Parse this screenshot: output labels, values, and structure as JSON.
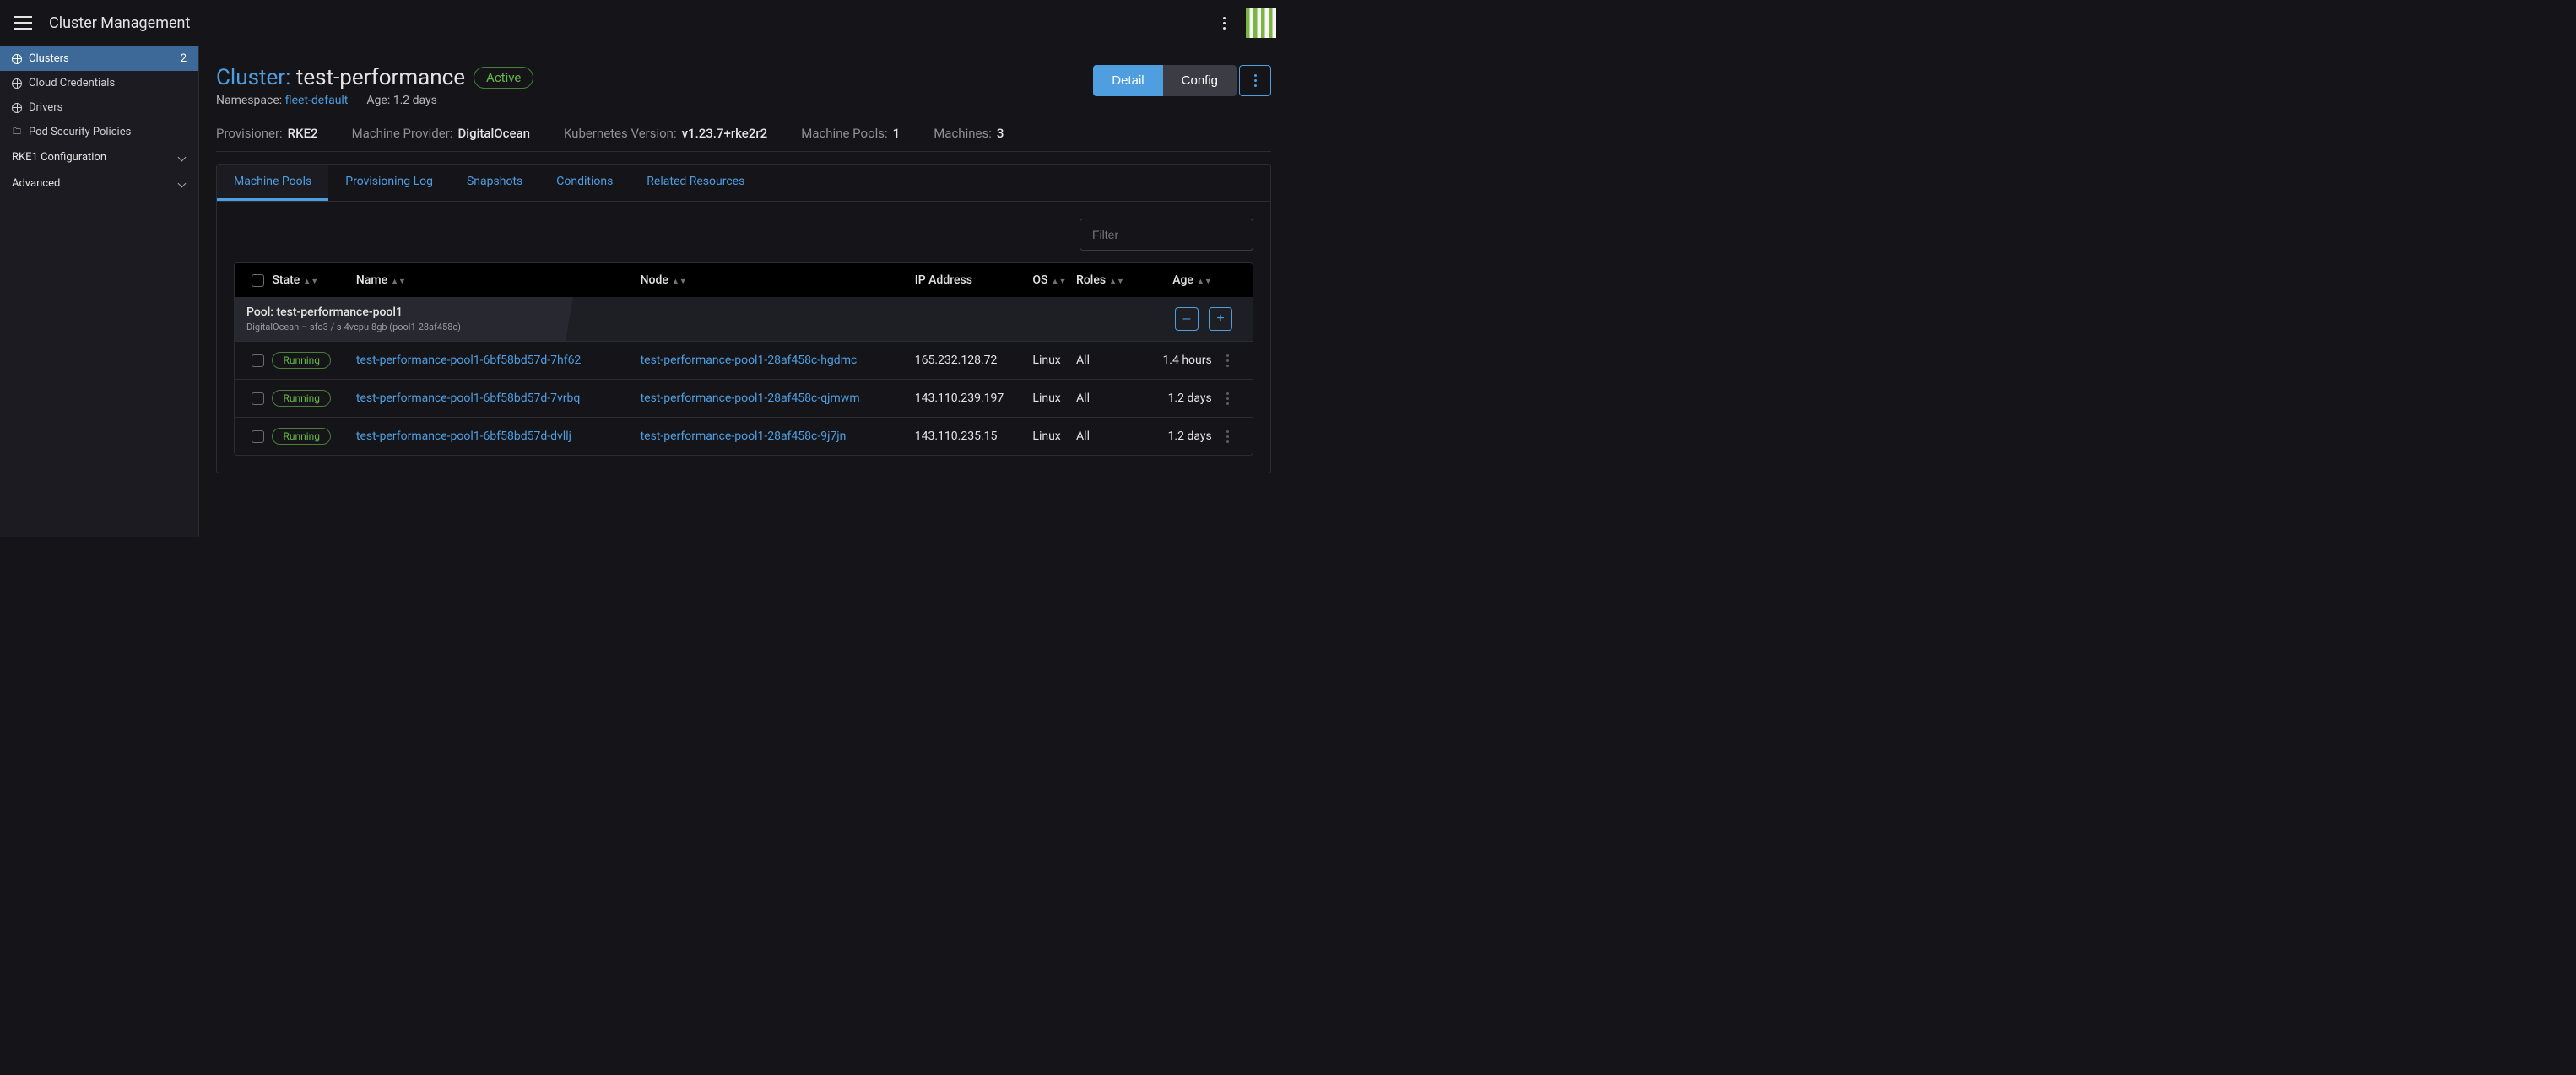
{
  "header": {
    "title": "Cluster Management"
  },
  "sidebar": {
    "items": [
      {
        "label": "Clusters",
        "count": "2",
        "icon": "globe",
        "active": true
      },
      {
        "label": "Cloud Credentials",
        "icon": "globe"
      },
      {
        "label": "Drivers",
        "icon": "globe"
      },
      {
        "label": "Pod Security Policies",
        "icon": "folder"
      }
    ],
    "groups": [
      {
        "label": "RKE1 Configuration"
      },
      {
        "label": "Advanced"
      }
    ]
  },
  "page": {
    "title_label": "Cluster:",
    "title_name": "test-performance",
    "status": "Active",
    "namespace_label": "Namespace:",
    "namespace_value": "fleet-default",
    "age_label": "Age:",
    "age_value": "1.2 days",
    "detail_btn": "Detail",
    "config_btn": "Config"
  },
  "info": {
    "provisioner_label": "Provisioner:",
    "provisioner_value": "RKE2",
    "machine_provider_label": "Machine Provider:",
    "machine_provider_value": "DigitalOcean",
    "k8s_label": "Kubernetes Version:",
    "k8s_value": "v1.23.7+rke2r2",
    "pools_label": "Machine Pools:",
    "pools_value": "1",
    "machines_label": "Machines:",
    "machines_value": "3"
  },
  "tabs": [
    {
      "label": "Machine Pools",
      "active": true
    },
    {
      "label": "Provisioning Log"
    },
    {
      "label": "Snapshots"
    },
    {
      "label": "Conditions"
    },
    {
      "label": "Related Resources"
    }
  ],
  "filter_placeholder": "Filter",
  "columns": {
    "state": "State",
    "name": "Name",
    "node": "Node",
    "ip": "IP Address",
    "os": "OS",
    "roles": "Roles",
    "age": "Age"
  },
  "pool": {
    "title": "Pool: test-performance-pool1",
    "subtitle": "DigitalOcean – sfo3 / s-4vcpu-8gb (pool1-28af458c)"
  },
  "rows": [
    {
      "state": "Running",
      "name": "test-performance-pool1-6bf58bd57d-7hf62",
      "node": "test-performance-pool1-28af458c-hgdmc",
      "ip": "165.232.128.72",
      "os": "Linux",
      "roles": "All",
      "age": "1.4 hours"
    },
    {
      "state": "Running",
      "name": "test-performance-pool1-6bf58bd57d-7vrbq",
      "node": "test-performance-pool1-28af458c-qjmwm",
      "ip": "143.110.239.197",
      "os": "Linux",
      "roles": "All",
      "age": "1.2 days"
    },
    {
      "state": "Running",
      "name": "test-performance-pool1-6bf58bd57d-dvllj",
      "node": "test-performance-pool1-28af458c-9j7jn",
      "ip": "143.110.235.15",
      "os": "Linux",
      "roles": "All",
      "age": "1.2 days"
    }
  ]
}
